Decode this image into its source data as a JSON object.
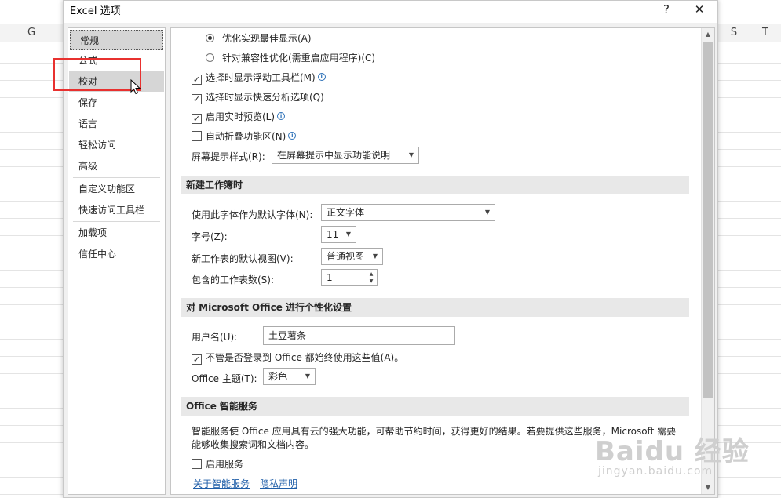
{
  "sheet": {
    "columns": [
      "G",
      "S",
      "T"
    ]
  },
  "dialog": {
    "title": "Excel 选项",
    "help_label": "?",
    "close_label": "✕"
  },
  "nav": {
    "items": [
      "常规",
      "公式",
      "校对",
      "保存",
      "语言",
      "轻松访问",
      "高级",
      "自定义功能区",
      "快速访问工具栏",
      "加载项",
      "信任中心"
    ],
    "selected": "常规",
    "hovered": "校对",
    "highlight_color": "#e8312f"
  },
  "content": {
    "radio_best": "优化实现最佳显示(A)",
    "radio_compat": "针对兼容性优化(需重启应用程序)(C)",
    "cb_float_toolbar": "选择时显示浮动工具栏(M)",
    "cb_quick_analysis": "选择时显示快速分析选项(Q)",
    "cb_live_preview": "启用实时预览(L)",
    "cb_collapse_ribbon": "自动折叠功能区(N)",
    "tooltip_style_label": "屏幕提示样式(R):",
    "tooltip_style_value": "在屏幕提示中显示功能说明",
    "section_new_workbook": "新建工作簿时",
    "default_font_label": "使用此字体作为默认字体(N):",
    "default_font_value": "正文字体",
    "font_size_label": "字号(Z):",
    "font_size_value": "11",
    "default_view_label": "新工作表的默认视图(V):",
    "default_view_value": "普通视图",
    "sheet_count_label": "包含的工作表数(S):",
    "sheet_count_value": "1",
    "section_personalize": "对 Microsoft Office 进行个性化设置",
    "username_label": "用户名(U):",
    "username_value": "土豆薯条",
    "cb_always_use": "不管是否登录到 Office 都始终使用这些值(A)。",
    "theme_label": "Office 主题(T):",
    "theme_value": "彩色",
    "section_intelligent": "Office 智能服务",
    "intelligent_desc": "智能服务使 Office 应用具有云的强大功能，可帮助节约时间，获得更好的结果。若要提供这些服务，Microsoft 需要能够收集搜索词和文档内容。",
    "cb_enable_services": "启用服务",
    "link_about": "关于智能服务",
    "link_privacy": "隐私声明"
  },
  "watermark": {
    "main": "Baidu 经验",
    "sub": "jingyan.baidu.com"
  }
}
